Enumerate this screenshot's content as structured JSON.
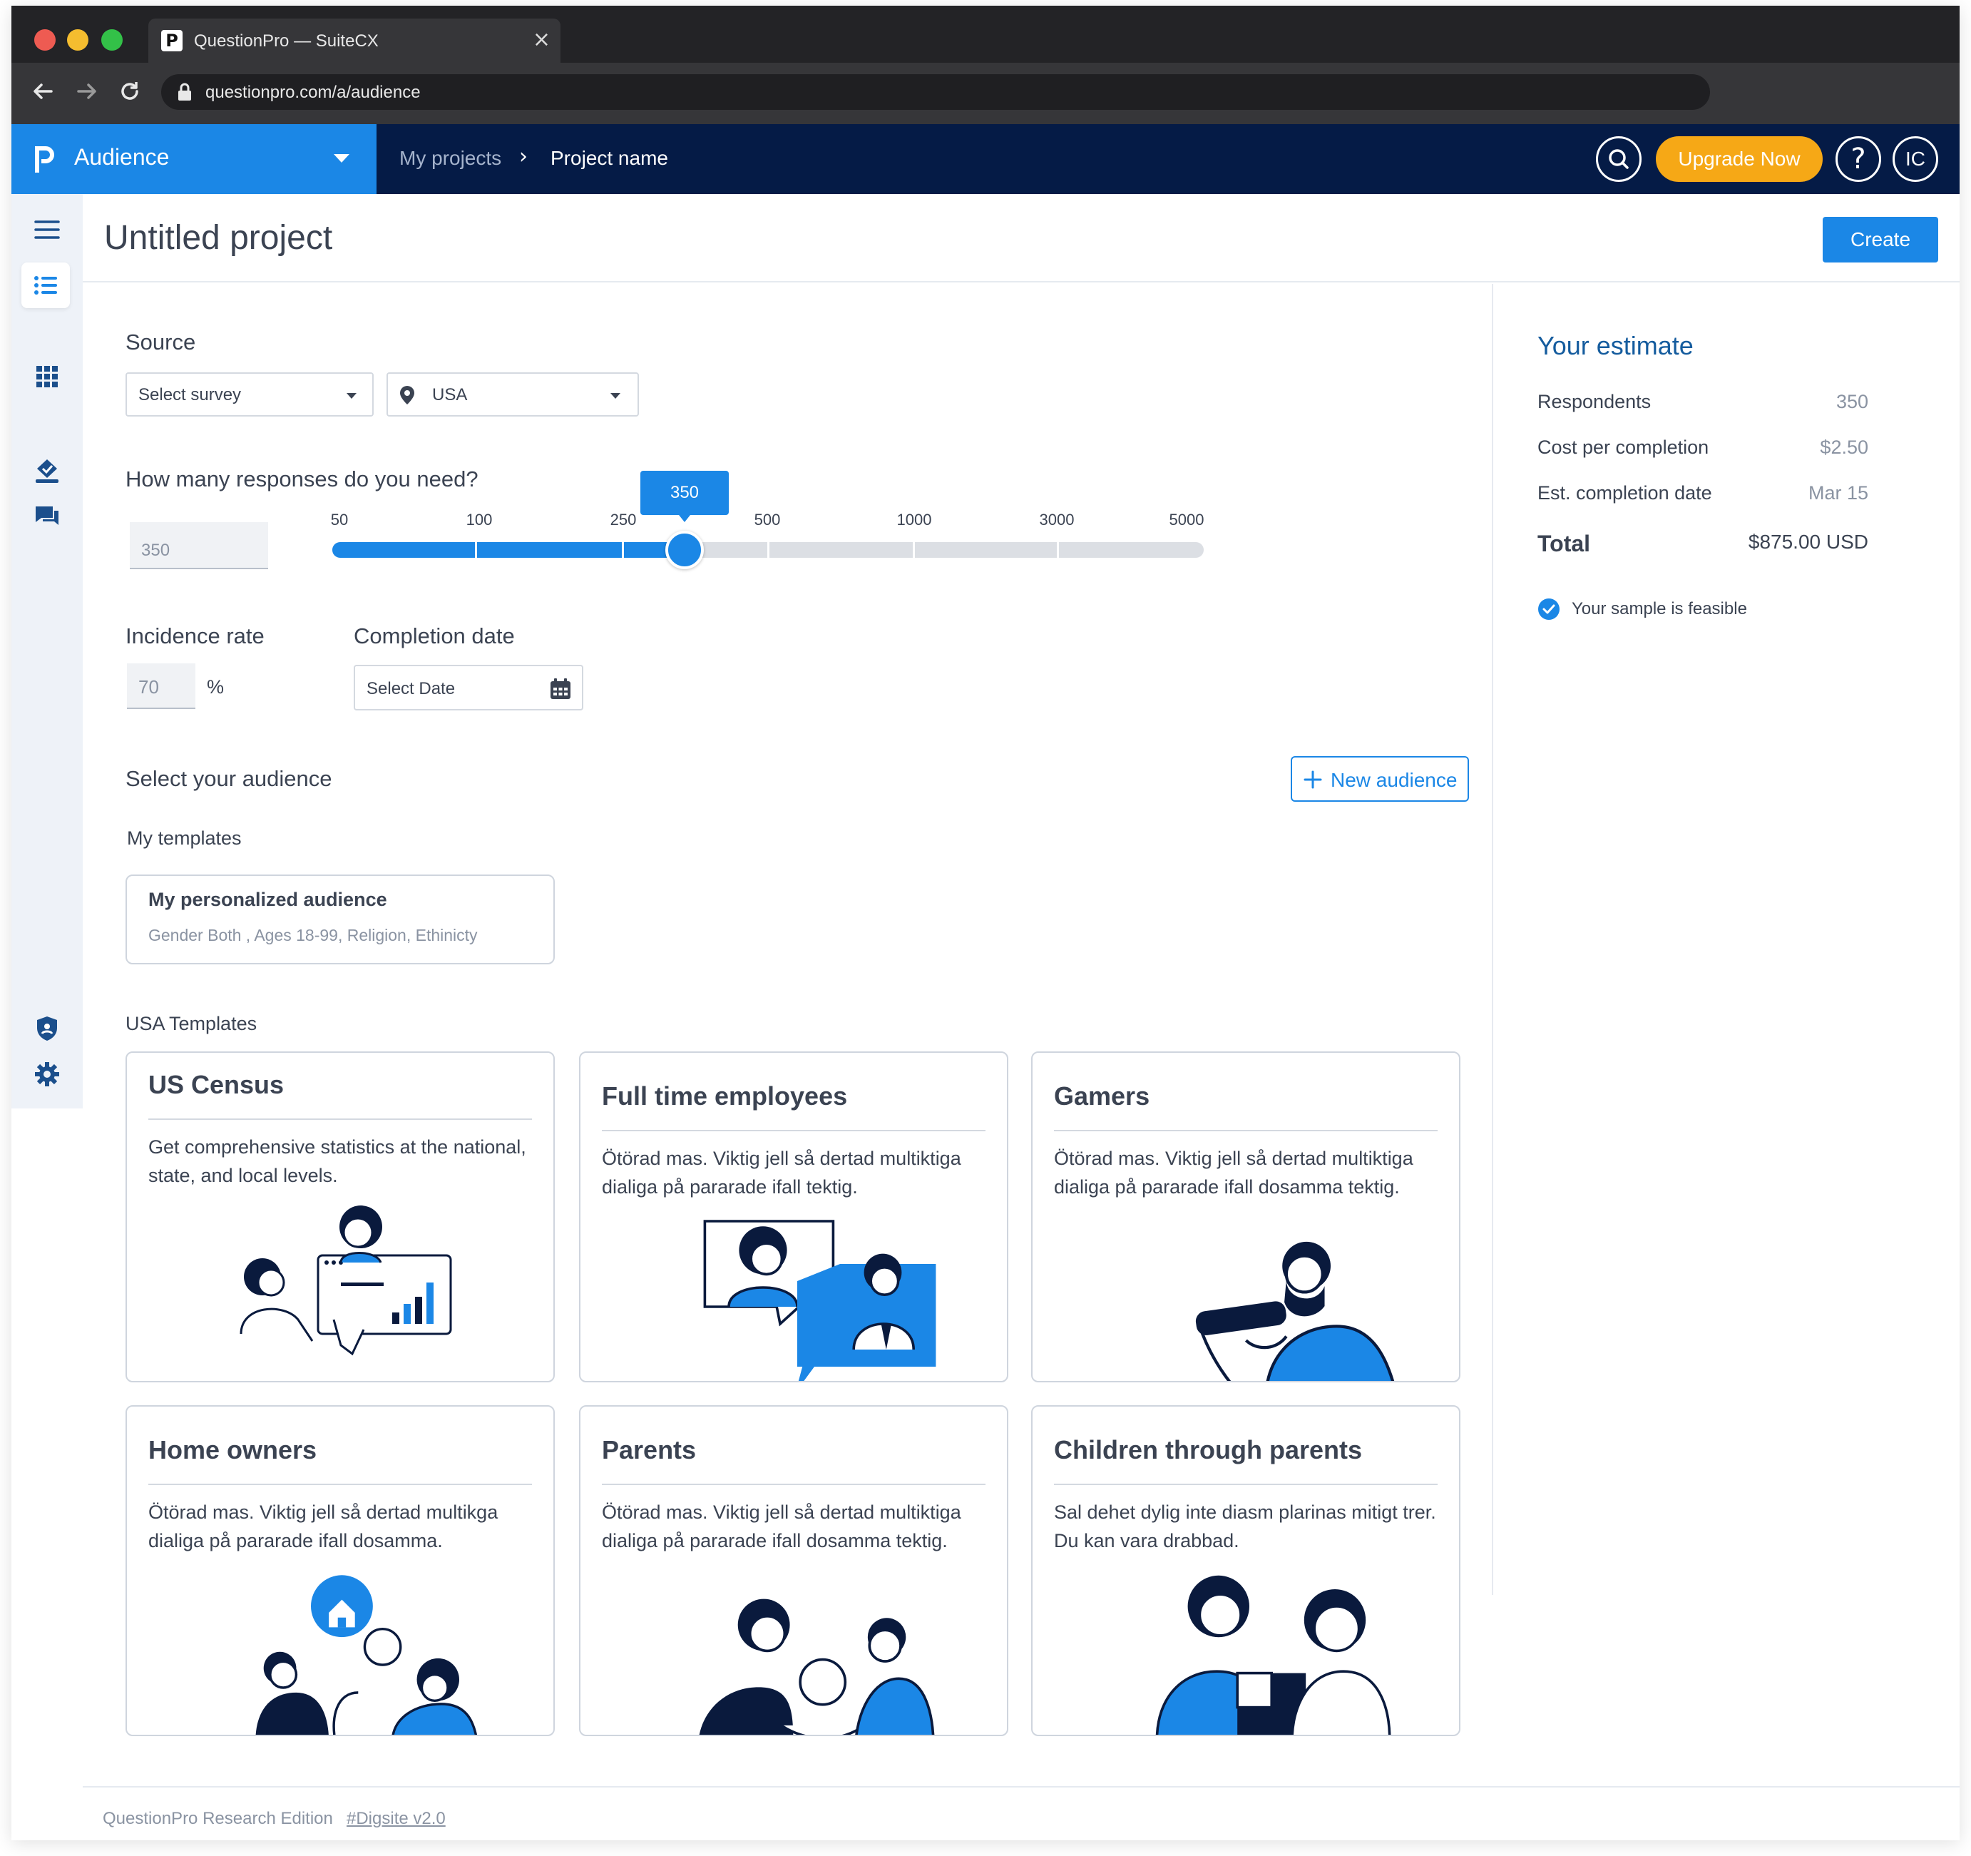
{
  "browser": {
    "tab_title": "QuestionPro — SuiteCX",
    "url": "questionpro.com/a/audience",
    "favicon_letter": "P"
  },
  "header": {
    "brand": "Audience",
    "breadcrumb": [
      "My projects",
      "Project name"
    ],
    "upgrade_label": "Upgrade Now",
    "help_label": "?",
    "avatar_initials": "IC"
  },
  "page": {
    "title": "Untitled project",
    "create_label": "Create"
  },
  "source": {
    "heading": "Source",
    "survey_select": "Select survey",
    "country_select": "USA"
  },
  "responses": {
    "heading": "How many responses do you need?",
    "value": "350",
    "slider_value": "350",
    "ticks": [
      "50",
      "100",
      "250",
      "500",
      "1000",
      "3000",
      "5000"
    ]
  },
  "incidence": {
    "heading": "Incidence rate",
    "value": "70",
    "unit": "%"
  },
  "completion": {
    "heading": "Completion date",
    "placeholder": "Select Date"
  },
  "audience": {
    "heading": "Select your audience",
    "new_label": "New audience",
    "my_templates_label": "My templates",
    "template": {
      "title": "My personalized audience",
      "desc": "Gender Both , Ages 18-99, Religion, Ethinicty"
    },
    "usa_templates_label": "USA Templates",
    "cards": [
      {
        "title": "US Census",
        "desc": "Get comprehensive statistics at the national, state, and local levels."
      },
      {
        "title": "Full time employees",
        "desc": "Ötörad mas. Viktig jell så dertad multiktiga dialiga på pararade ifall tektig."
      },
      {
        "title": "Gamers",
        "desc": "Ötörad mas. Viktig jell så dertad multiktiga dialiga på pararade ifall dosamma tektig."
      },
      {
        "title": "Home owners",
        "desc": "Ötörad mas. Viktig jell så dertad multikga dialiga på pararade ifall dosamma."
      },
      {
        "title": "Parents",
        "desc": "Ötörad mas. Viktig jell så dertad multiktiga dialiga på pararade ifall dosamma tektig."
      },
      {
        "title": "Children through parents",
        "desc": "Sal dehet dylig inte diasm plarinas mitigt trer. Du kan vara drabbad."
      }
    ]
  },
  "estimate": {
    "title": "Your estimate",
    "rows": [
      {
        "label": "Respondents",
        "value": "350"
      },
      {
        "label": "Cost per completion",
        "value": "$2.50"
      },
      {
        "label": "Est. completion date",
        "value": "Mar 15"
      }
    ],
    "total_label": "Total",
    "total_value": "$875.00 USD",
    "feasible_text": "Your sample is feasible"
  },
  "footer": {
    "edition": "QuestionPro Research Edition",
    "link": "#Digsite v2.0"
  },
  "colors": {
    "brand_blue": "#1b87e6",
    "navy": "#051b46",
    "upgrade_orange": "#f6a816"
  }
}
